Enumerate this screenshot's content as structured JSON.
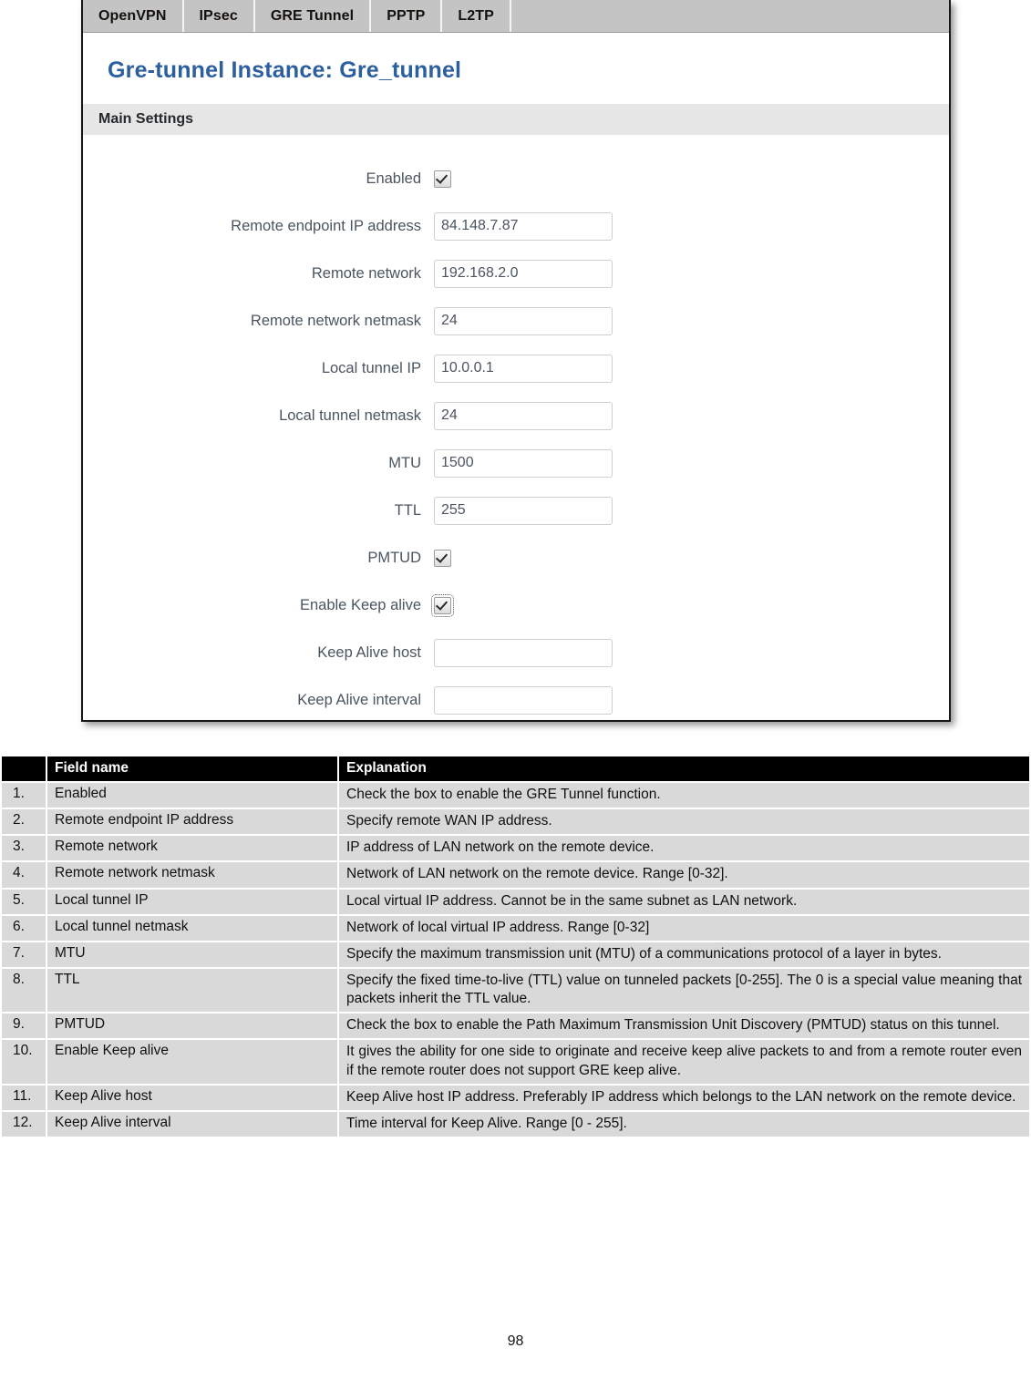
{
  "screenshot": {
    "tabs": [
      {
        "label": "OpenVPN"
      },
      {
        "label": "IPsec"
      },
      {
        "label": "GRE Tunnel"
      },
      {
        "label": "PPTP"
      },
      {
        "label": "L2TP"
      }
    ],
    "title": "Gre-tunnel Instance: Gre_tunnel",
    "section_title": "Main Settings",
    "fields": [
      {
        "label": "Enabled",
        "type": "checkbox",
        "checked": true,
        "focused": false
      },
      {
        "label": "Remote endpoint IP address",
        "type": "text",
        "value": "84.148.7.87"
      },
      {
        "label": "Remote network",
        "type": "text",
        "value": "192.168.2.0"
      },
      {
        "label": "Remote network netmask",
        "type": "text",
        "value": "24"
      },
      {
        "label": "Local tunnel IP",
        "type": "text",
        "value": "10.0.0.1"
      },
      {
        "label": "Local tunnel netmask",
        "type": "text",
        "value": "24"
      },
      {
        "label": "MTU",
        "type": "text",
        "value": "1500"
      },
      {
        "label": "TTL",
        "type": "text",
        "value": "255"
      },
      {
        "label": "PMTUD",
        "type": "checkbox",
        "checked": true,
        "focused": false
      },
      {
        "label": "Enable Keep alive",
        "type": "checkbox",
        "checked": true,
        "focused": true
      },
      {
        "label": "Keep Alive host",
        "type": "text",
        "value": ""
      },
      {
        "label": "Keep Alive interval",
        "type": "text",
        "value": ""
      }
    ]
  },
  "table": {
    "headers": {
      "num": "",
      "field": "Field name",
      "explanation": "Explanation"
    },
    "rows": [
      {
        "num": "1.",
        "field": "Enabled",
        "explanation": "Check the box to enable the GRE Tunnel function.",
        "justify": false
      },
      {
        "num": "2.",
        "field": "Remote endpoint IP address",
        "explanation": "Specify remote WAN IP address.",
        "justify": false
      },
      {
        "num": "3.",
        "field": "Remote network",
        "explanation": "IP address of LAN network on the remote device.",
        "justify": false
      },
      {
        "num": "4.",
        "field": "Remote network netmask",
        "explanation": "Network of LAN network on the remote device. Range [0-32].",
        "justify": false
      },
      {
        "num": "5.",
        "field": "Local tunnel IP",
        "explanation": "Local virtual IP address. Cannot be in the same subnet as LAN network.",
        "justify": false
      },
      {
        "num": "6.",
        "field": "Local tunnel netmask",
        "explanation": "Network of local virtual IP address. Range [0-32]",
        "justify": false
      },
      {
        "num": "7.",
        "field": "MTU",
        "explanation": "Specify the maximum transmission unit (MTU) of a communications protocol of a layer in bytes.",
        "justify": true
      },
      {
        "num": "8.",
        "field": "TTL",
        "explanation": "Specify the fixed time-to-live (TTL) value on tunneled packets [0-255]. The 0 is a special value meaning that packets inherit the TTL value.",
        "justify": true
      },
      {
        "num": "9.",
        "field": "PMTUD",
        "explanation": "Check the box to enable the Path Maximum Transmission Unit Discovery (PMTUD) status on this tunnel.",
        "justify": true
      },
      {
        "num": "10.",
        "field": "Enable Keep alive",
        "explanation": "It gives the ability for one side to originate and receive keep alive packets to and from a remote router even if the remote router does not support GRE keep alive.",
        "justify": true
      },
      {
        "num": "11.",
        "field": "Keep Alive host",
        "explanation": "Keep Alive host IP address. Preferably IP address which belongs to the LAN network on the remote device.",
        "justify": true
      },
      {
        "num": "12.",
        "field": "Keep Alive interval",
        "explanation": "Time interval for Keep Alive. Range [0 - 255].",
        "justify": false
      }
    ]
  },
  "page_number": "98"
}
